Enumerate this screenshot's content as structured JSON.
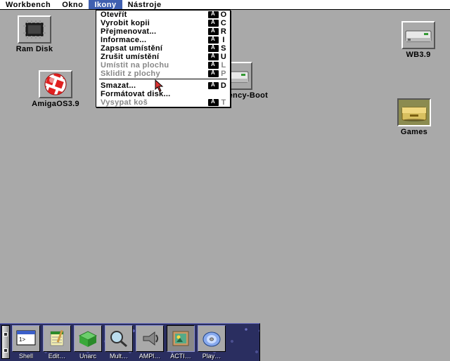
{
  "menubar": {
    "items": [
      {
        "label": "Workbench"
      },
      {
        "label": "Okno"
      },
      {
        "label": "Ikony",
        "active": true
      },
      {
        "label": "Nástroje"
      }
    ]
  },
  "dropdown": {
    "open": [
      {
        "label": "Otevřít",
        "shortcut": "O"
      },
      {
        "label": "Vyrobit kopii",
        "shortcut": "C"
      },
      {
        "label": "Přejmenovat...",
        "shortcut": "R"
      },
      {
        "label": "Informace...",
        "shortcut": "I"
      },
      {
        "label": "Zapsat umístění",
        "shortcut": "S"
      },
      {
        "label": "Zrušit umístění",
        "shortcut": "U"
      },
      {
        "label": "Umístit na plochu",
        "shortcut": "L",
        "disabled": true
      },
      {
        "label": "Sklidit z plochy",
        "shortcut": "P",
        "disabled": true
      }
    ],
    "format": [
      {
        "label": "Smazat...",
        "shortcut": "D"
      },
      {
        "label": "Formátovat disk...",
        "shortcut": null
      },
      {
        "label": "Vysypat koš",
        "shortcut": "T",
        "disabled": true
      }
    ]
  },
  "desktop": {
    "ramdisk": {
      "label": "Ram Disk"
    },
    "wb": {
      "label": "WB3.9"
    },
    "amigaos": {
      "label": "AmigaOS3.9"
    },
    "emergency": {
      "label": "Emergency-Boot"
    },
    "games": {
      "label": "Games"
    }
  },
  "dock": {
    "items": [
      {
        "label": "Shell",
        "kind": "shell"
      },
      {
        "label": "Edit…",
        "kind": "edit"
      },
      {
        "label": "Unarc",
        "kind": "unarc"
      },
      {
        "label": "Mult…",
        "kind": "multi"
      },
      {
        "label": "AMPl…",
        "kind": "ampl"
      },
      {
        "label": "ACTI…",
        "kind": "acti",
        "active": true
      },
      {
        "label": "Play…",
        "kind": "play"
      }
    ]
  }
}
